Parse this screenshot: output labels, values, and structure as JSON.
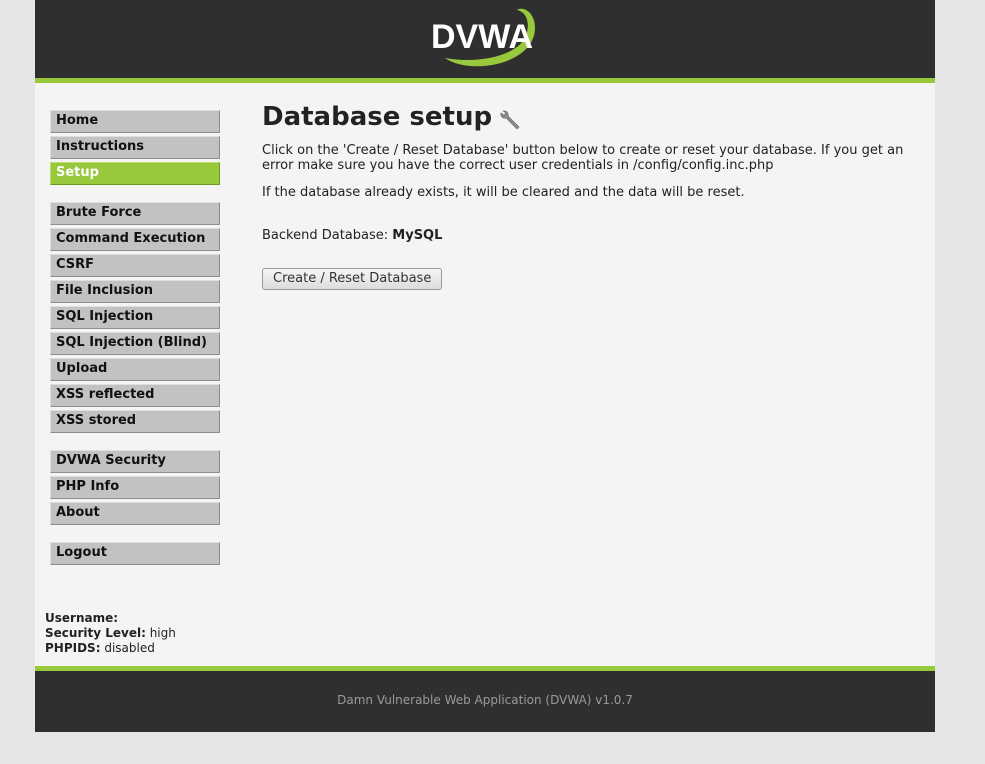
{
  "header": {
    "logo_text": "DVWA"
  },
  "menu": {
    "blocks": [
      [
        {
          "label": "Home"
        },
        {
          "label": "Instructions"
        },
        {
          "label": "Setup",
          "selected": true
        }
      ],
      [
        {
          "label": "Brute Force"
        },
        {
          "label": "Command Execution"
        },
        {
          "label": "CSRF"
        },
        {
          "label": "File Inclusion"
        },
        {
          "label": "SQL Injection"
        },
        {
          "label": "SQL Injection (Blind)"
        },
        {
          "label": "Upload"
        },
        {
          "label": "XSS reflected"
        },
        {
          "label": "XSS stored"
        }
      ],
      [
        {
          "label": "DVWA Security"
        },
        {
          "label": "PHP Info"
        },
        {
          "label": "About"
        }
      ],
      [
        {
          "label": "Logout"
        }
      ]
    ]
  },
  "main": {
    "title": "Database setup",
    "title_icon": "wrench-icon",
    "intro": "Click on the 'Create / Reset Database' button below to create or reset your database. If you get an error make sure you have the correct user credentials in /config/config.inc.php",
    "note": "If the database already exists, it will be cleared and the data will be reset.",
    "backend_label": "Backend Database:",
    "backend_value": "MySQL",
    "create_button": "Create / Reset Database"
  },
  "system_info": {
    "username_label": "Username:",
    "username_value": "",
    "security_label": "Security Level:",
    "security_value": "high",
    "phpids_label": "PHPIDS:",
    "phpids_value": "disabled"
  },
  "footer": {
    "text": "Damn Vulnerable Web Application (DVWA) v1.0.7"
  },
  "colors": {
    "accent": "#98c83c",
    "header_bg": "#2f2f2f",
    "page_bg": "#f4f4f4"
  }
}
